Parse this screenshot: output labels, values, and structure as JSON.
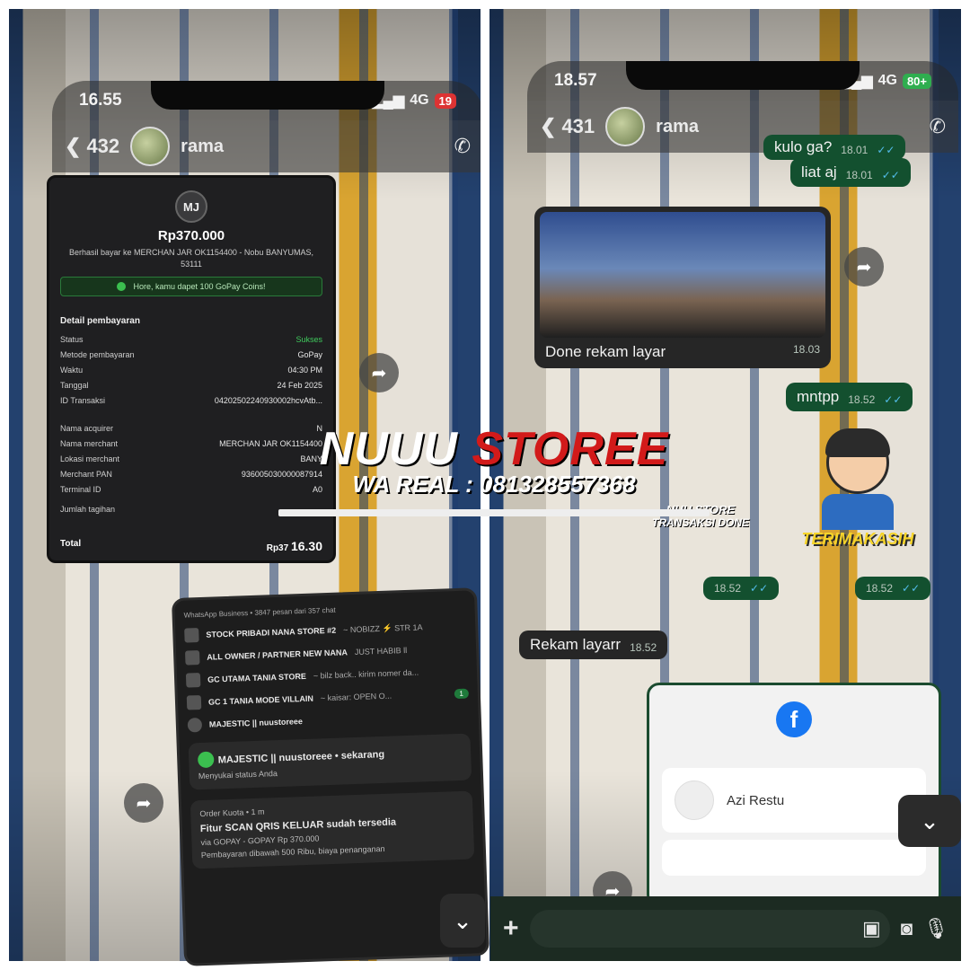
{
  "left": {
    "status": {
      "time": "16.55",
      "network": "4G",
      "battery": "19"
    },
    "header": {
      "back_count": "432",
      "name": "rama"
    },
    "receipt": {
      "initials": "MJ",
      "amount": "Rp370.000",
      "merchant_line": "Berhasil bayar ke MERCHAN JAR OK1154400 - Nobu BANYUMAS, 53111",
      "coins_text": "Hore, kamu dapet 100 GoPay Coins!",
      "detail_title": "Detail pembayaran",
      "rows": [
        {
          "label": "Status",
          "value": "Sukses"
        },
        {
          "label": "Metode pembayaran",
          "value": "GoPay"
        },
        {
          "label": "Waktu",
          "value": "04:30 PM"
        },
        {
          "label": "Tanggal",
          "value": "24 Feb 2025"
        },
        {
          "label": "ID Transaksi",
          "value": "04202502240930002hcvAtb..."
        }
      ],
      "rows2": [
        {
          "label": "Nama acquirer",
          "value": "N"
        },
        {
          "label": "Nama merchant",
          "value": "MERCHAN JAR OK1154400"
        },
        {
          "label": "Lokasi merchant",
          "value": "BANY"
        },
        {
          "label": "Merchant PAN",
          "value": "936005030000087914"
        },
        {
          "label": "Terminal ID",
          "value": "A0"
        }
      ],
      "jumlah": "Jumlah tagihan",
      "total_label": "Total",
      "total_value": "Rp37",
      "overlay_time": "16.30"
    },
    "notifications": {
      "header": "WhatsApp Business • 3847 pesan dari 357 chat",
      "items": [
        {
          "name": "STOCK PRIBADI NANA STORE #2",
          "preview": "~ NOBIZZ ⚡ STR 1A"
        },
        {
          "name": "ALL OWNER / PARTNER NEW NANA",
          "preview": "JUST HABIB ll"
        },
        {
          "name": "GC UTAMA TANIA STORE",
          "preview": "~ bilz back.. kirim nomer da..."
        },
        {
          "name": "GC 1 TANIA MODE VILLAIN",
          "preview": "~ kaisar: OPEN O..."
        },
        {
          "name": "MAJESTIC || nuustoreee",
          "preview": ""
        }
      ],
      "badge": "1",
      "status_title": "MAJESTIC || nuustoreee • sekarang",
      "status_text": "Menyukai status Anda",
      "order_src": "Order Kuota • 1 m",
      "order_title": "Fitur SCAN QRIS KELUAR sudah tersedia",
      "order_line1": "via GOPAY - GOPAY Rp 370.000",
      "order_line2": "Pembayaran dibawah 500 Ribu, biaya penanganan"
    }
  },
  "right": {
    "status": {
      "time": "18.57",
      "network": "4G",
      "battery": "80+"
    },
    "header": {
      "back_count": "431",
      "name": "rama"
    },
    "msgs": [
      {
        "text": "kulo  ga?",
        "time": "18.01"
      },
      {
        "text": "liat aj",
        "time": "18.01"
      },
      {
        "text": "mntpp",
        "time": "18.52"
      },
      {
        "text": "",
        "time": "18.52"
      },
      {
        "text": "",
        "time": "18.52"
      }
    ],
    "video_caption": "Done rekam layar",
    "video_time": "18.03",
    "incoming": {
      "text": "Rekam layarr",
      "time": "18.52"
    },
    "sticker_text": "TERIMAKASIH",
    "sticker_mini_brand": "NUU STORE",
    "sticker_mini": "TRANSAKSI DONE",
    "fb_account": "Azi Restu"
  },
  "watermark": {
    "brand_white": "NUUU",
    "brand_red": "STOREE",
    "wa": "WA REAL : 081328557368"
  },
  "colors": {
    "accent_green": "#13502f",
    "brand_red": "#d21a1a",
    "tick_blue": "#53bdeb"
  }
}
